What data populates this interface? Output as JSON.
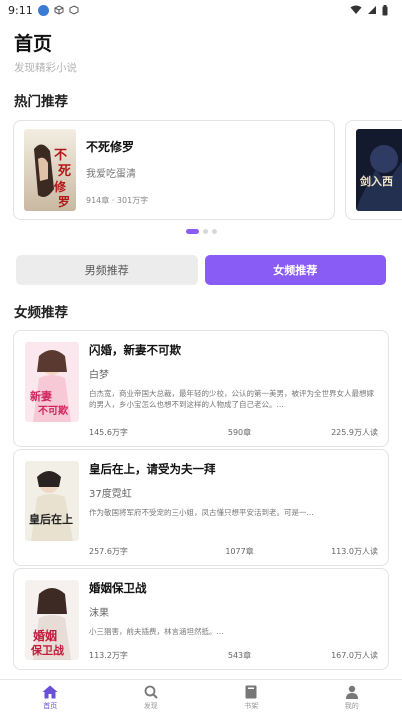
{
  "status_bar": {
    "time": "9:11"
  },
  "header": {
    "title": "首页",
    "subtitle": "发现精彩小说"
  },
  "hot_section": {
    "title": "热门推荐",
    "card": {
      "name": "不死修罗",
      "author": "我爱吃蛋清",
      "meta": "914章 · 301万字",
      "cover_text": "不死修罗"
    },
    "next_card": {
      "cover_text": "剑入西厢"
    },
    "page_count": 3,
    "active_page": 0
  },
  "gender_tabs": {
    "male": "男频推荐",
    "female": "女频推荐",
    "selected": "female"
  },
  "rec_section": {
    "title": "女频推荐",
    "books": [
      {
        "name": "闪婚，新妻不可欺",
        "author": "白梦",
        "desc": "白杰宽，商业帝国大总裁，最年轻的少校，公认的第一美男，被评为全世界女人最想嫁的男人，乡小宝怎么也想不到这样的人物成了自己老公。...",
        "words": "145.6万字",
        "chapters": "590章",
        "readers": "225.9万人读",
        "cover_text": "新妻不可欺"
      },
      {
        "name": "皇后在上，请受为夫一拜",
        "author": "37度霓虹",
        "desc": "作为敬国将军府不受宠的三小姐，凤古懂只想平安活到老。可是一...",
        "words": "257.6万字",
        "chapters": "1077章",
        "readers": "113.0万人读",
        "cover_text": "皇后在上"
      },
      {
        "name": "婚姻保卫战",
        "author": "沫果",
        "desc": "小三猖害，前夫插费，林言涵坦然抵。...",
        "words": "113.2万字",
        "chapters": "543章",
        "readers": "167.0万人读",
        "cover_text": "婚姻保卫战"
      }
    ]
  },
  "bottom_nav": [
    {
      "label": "首页",
      "icon": "home-icon",
      "active": true
    },
    {
      "label": "发现",
      "icon": "search-icon",
      "active": false
    },
    {
      "label": "书架",
      "icon": "bookshelf-icon",
      "active": false
    },
    {
      "label": "我的",
      "icon": "profile-icon",
      "active": false
    }
  ],
  "colors": {
    "accent": "#8a5cf6",
    "tab_inactive": "#ececec"
  }
}
